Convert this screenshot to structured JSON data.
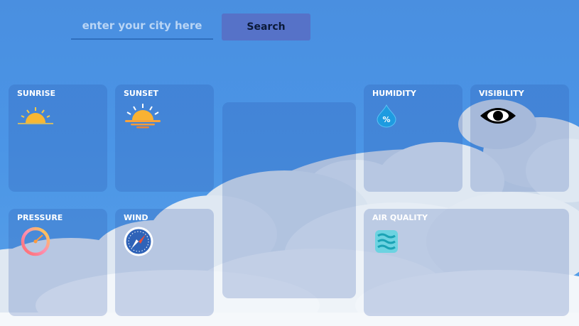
{
  "search": {
    "placeholder": "enter your city here",
    "button_label": "Search"
  },
  "cards": {
    "sunrise": {
      "title": "SUNRISE",
      "icon": "sunrise-icon"
    },
    "sunset": {
      "title": "SUNSET",
      "icon": "sunset-icon"
    },
    "humidity": {
      "title": "HUMIDITY",
      "icon": "humidity-icon"
    },
    "visibility": {
      "title": "VISIBILITY",
      "icon": "eye-icon"
    },
    "pressure": {
      "title": "PRESSURE",
      "icon": "gauge-icon"
    },
    "wind": {
      "title": "WIND",
      "icon": "compass-icon"
    },
    "air_quality": {
      "title": "AIR QUALITY",
      "icon": "air-quality-icon"
    }
  },
  "colors": {
    "background": "#4a8fe0",
    "button": "#5672c8",
    "card_overlay": "rgba(40,80,170,0.22)"
  }
}
